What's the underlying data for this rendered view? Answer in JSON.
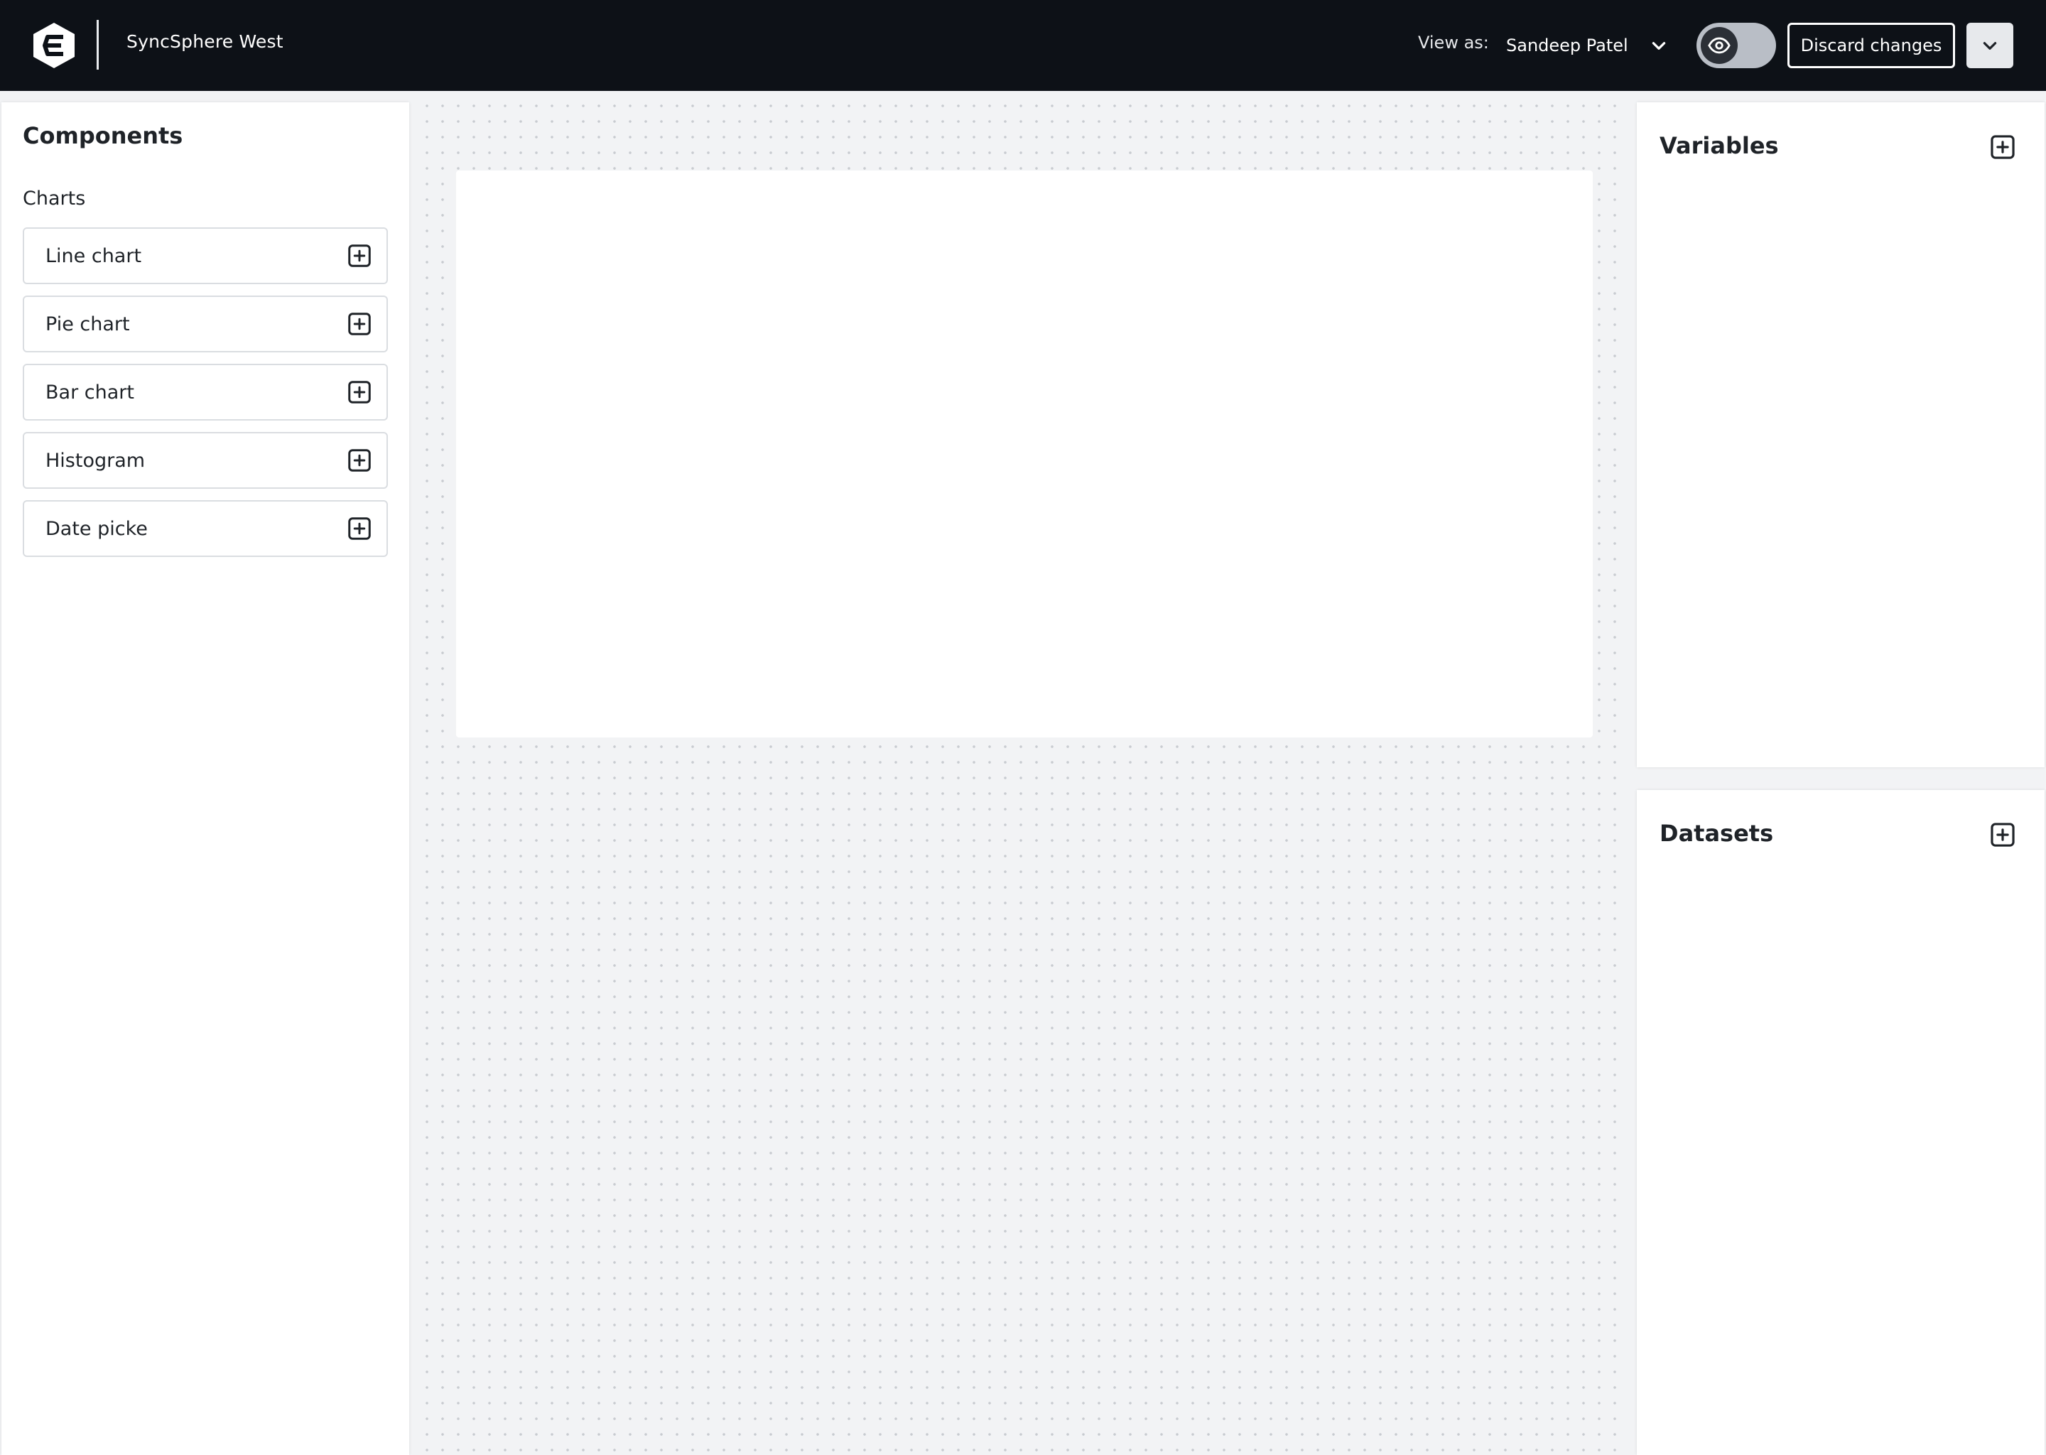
{
  "header": {
    "app_name": "SyncSphere West",
    "view_as_label": "View as:",
    "view_as_user": "Sandeep Patel",
    "discard_label": "Discard changes"
  },
  "components_panel": {
    "title": "Components",
    "section_label": "Charts",
    "items": [
      {
        "label": "Line chart",
        "icon": "plus-square-icon"
      },
      {
        "label": "Pie chart",
        "icon": "plus-square-icon"
      },
      {
        "label": "Bar chart",
        "icon": "plus-square-icon"
      },
      {
        "label": "Histogram",
        "icon": "plus-square-icon"
      },
      {
        "label": "Date picke",
        "icon": "plus-square-icon"
      }
    ]
  },
  "variables_panel": {
    "title": "Variables"
  },
  "datasets_panel": {
    "title": "Datasets"
  },
  "colors": {
    "topbar_bg": "#0d1117",
    "canvas_bg": "#f2f3f5",
    "panel_bg": "#ffffff",
    "border": "#dadde1"
  }
}
